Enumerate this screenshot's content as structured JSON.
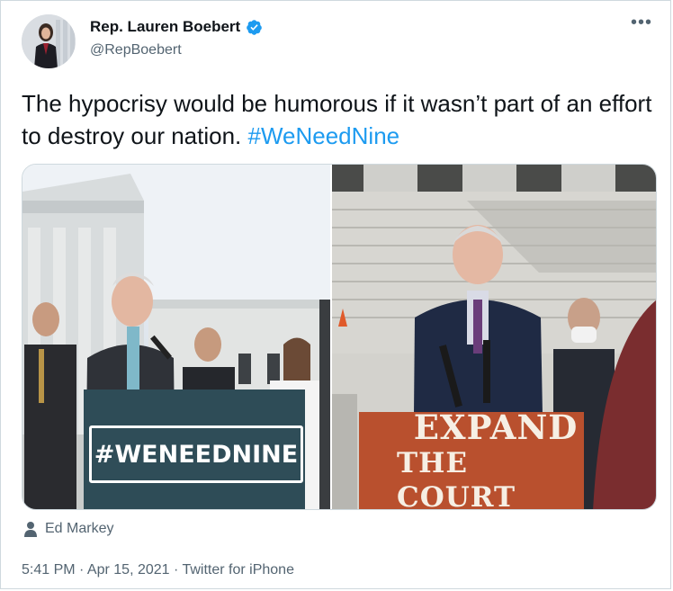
{
  "author": {
    "display_name": "Rep. Lauren Boebert",
    "handle": "@RepBoebert",
    "verified": true
  },
  "more_menu": "•••",
  "tweet": {
    "text": "The hypocrisy would be humorous if it wasn’t part of an effort to destroy our nation.",
    "hashtag": "#WeNeedNine"
  },
  "media": {
    "left_sign": "#WENEEDNINE",
    "right_sign_line1": "EXPAND",
    "right_sign_line2": "THE COURT"
  },
  "tagged_person": {
    "icon": "person-icon",
    "name": "Ed Markey"
  },
  "meta": {
    "time": "5:41 PM",
    "date": "Apr 15, 2021",
    "source": "Twitter for iPhone",
    "line": "5:41 PM · Apr 15, 2021 · Twitter for iPhone"
  },
  "colors": {
    "link": "#1d9bf0",
    "secondary_text": "#536471",
    "verified_badge": "#1d9bf0"
  }
}
